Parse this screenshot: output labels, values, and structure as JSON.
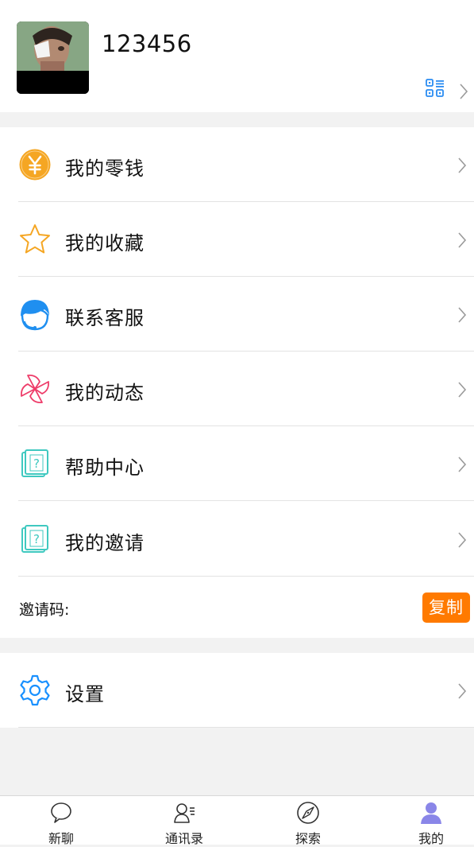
{
  "profile": {
    "username": "123456",
    "avatar_icon": "user-avatar-photo",
    "qr_icon": "qr-code-icon",
    "chevron_icon": "chevron-right-icon"
  },
  "menu": [
    {
      "key": "wallet",
      "label": "我的零钱",
      "icon": "yuan-coin-icon"
    },
    {
      "key": "favorites",
      "label": "我的收藏",
      "icon": "star-icon"
    },
    {
      "key": "customer-service",
      "label": "联系客服",
      "icon": "headset-agent-icon"
    },
    {
      "key": "moments",
      "label": "我的动态",
      "icon": "pinwheel-icon"
    },
    {
      "key": "help",
      "label": "帮助中心",
      "icon": "help-card-icon"
    },
    {
      "key": "invites",
      "label": "我的邀请",
      "icon": "help-card-icon"
    }
  ],
  "invite": {
    "label": "邀请码:",
    "copy_label": "复制"
  },
  "settings": {
    "label": "设置",
    "icon": "gear-icon"
  },
  "tabs": [
    {
      "key": "chat",
      "label": "新聊",
      "icon": "chat-bubble-icon"
    },
    {
      "key": "contacts",
      "label": "通讯录",
      "icon": "contacts-icon"
    },
    {
      "key": "discover",
      "label": "探索",
      "icon": "compass-icon"
    },
    {
      "key": "me",
      "label": "我的",
      "icon": "person-icon",
      "active": true
    }
  ],
  "colors": {
    "accent_orange": "#ff7a00",
    "coin_gold": "#f5a623",
    "service_blue": "#1f8ff0",
    "pinwheel_pink": "#ee3d6a",
    "help_teal": "#3fc9c0",
    "settings_blue": "#1890ff",
    "active_tab_purple": "#8a86e8",
    "qr_blue": "#2a8cf2"
  }
}
